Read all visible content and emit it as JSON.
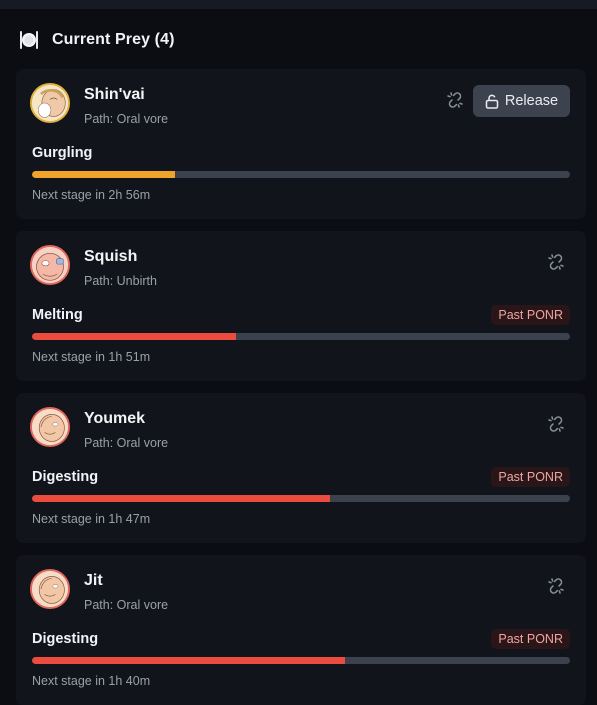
{
  "header": {
    "title": "Current Prey (4)",
    "icon": "plate-cutlery-icon"
  },
  "colors": {
    "progress_warning": "#f0a52a",
    "progress_danger": "#ec4c3d",
    "track": "#3b424e",
    "badge_bg": "#2a1518",
    "badge_text": "#f0a6a0"
  },
  "prey": [
    {
      "name": "Shin'vai",
      "path": "Path: Oral vore",
      "stage": "Gurgling",
      "progress": 0.265,
      "next_stage": "Next stage in 2h 56m",
      "release_label": "Release",
      "avatar_ring": "#e3b13a",
      "avatar_bg": "#f6e6c8"
    },
    {
      "name": "Squish",
      "path": "Path: Unbirth",
      "stage": "Melting",
      "badge": "Past PONR",
      "progress": 0.38,
      "next_stage": "Next stage in 1h 51m",
      "avatar_ring": "#e2675c",
      "avatar_bg": "#f7d2c4"
    },
    {
      "name": "Youmek",
      "path": "Path: Oral vore",
      "stage": "Digesting",
      "badge": "Past PONR",
      "progress": 0.553,
      "next_stage": "Next stage in 1h 47m",
      "avatar_ring": "#e2675c",
      "avatar_bg": "#f7dcc7"
    },
    {
      "name": "Jit",
      "path": "Path: Oral vore",
      "stage": "Digesting",
      "badge": "Past PONR",
      "progress": 0.582,
      "next_stage": "Next stage in 1h 40m",
      "avatar_ring": "#e2675c",
      "avatar_bg": "#f7dcc7"
    }
  ]
}
